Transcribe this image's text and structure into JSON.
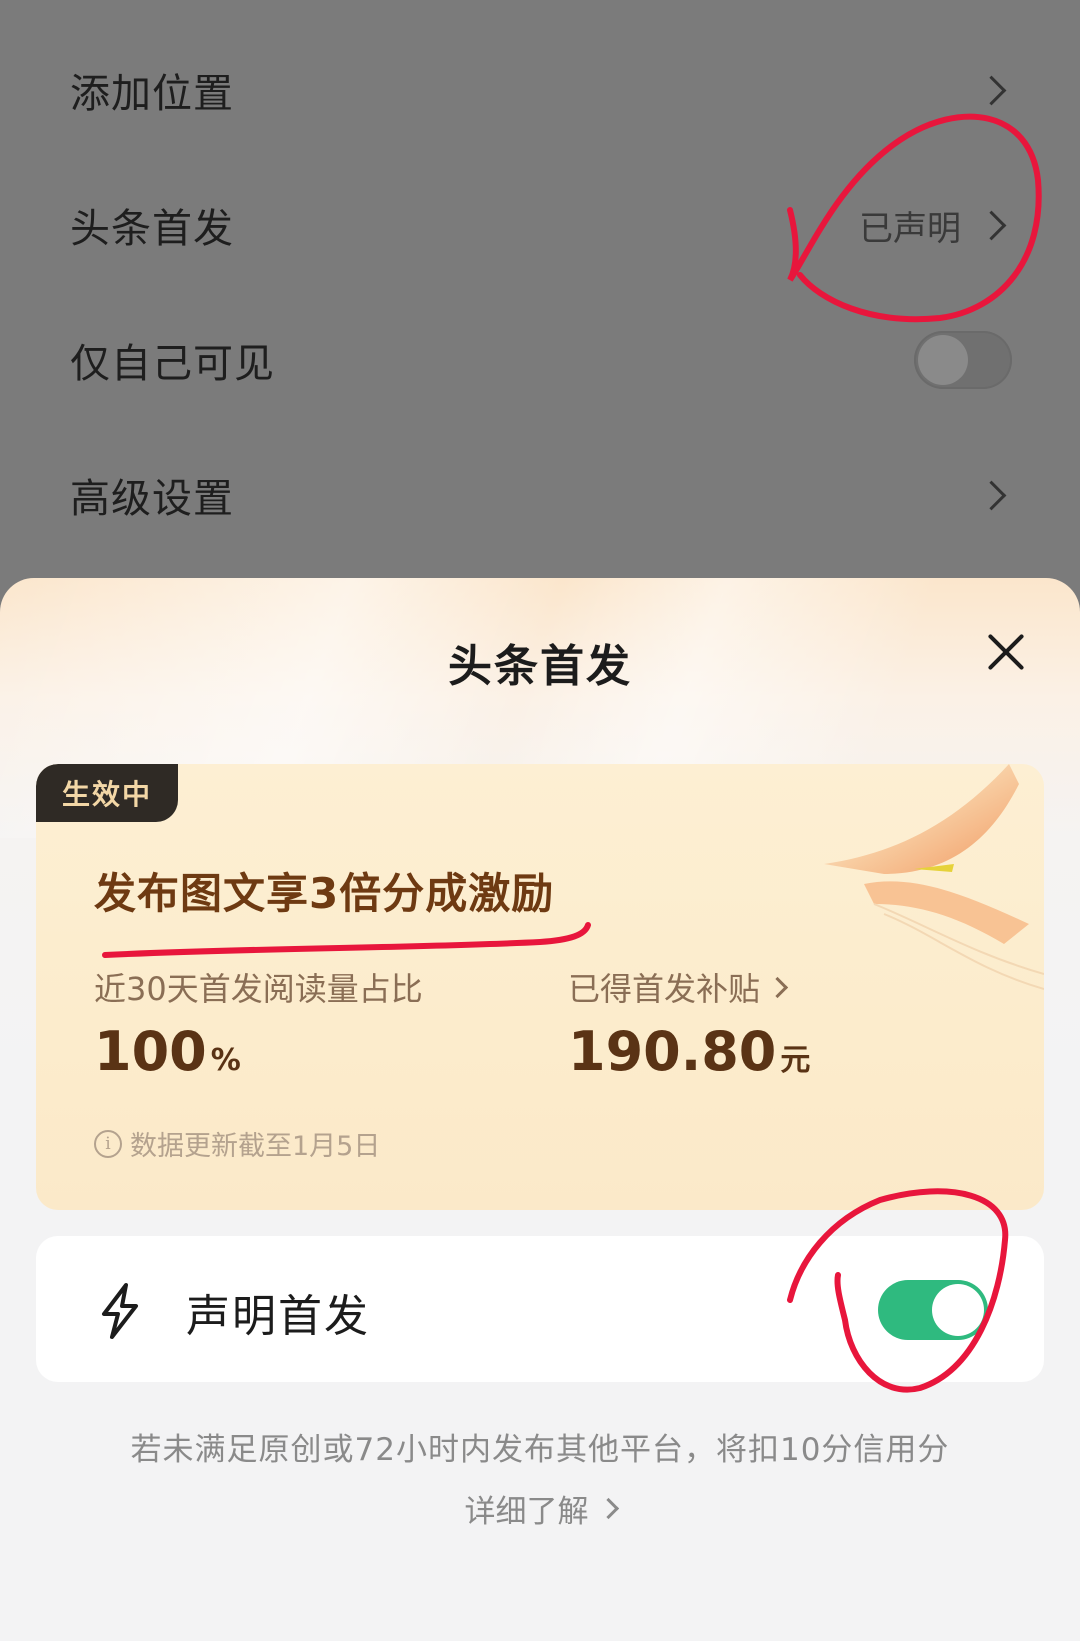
{
  "settings": {
    "rows": [
      {
        "label": "添加位置"
      },
      {
        "label": "头条首发",
        "value": "已声明"
      },
      {
        "label": "仅自己可见"
      },
      {
        "label": "高级设置"
      }
    ]
  },
  "sheet": {
    "title": "头条首发",
    "card": {
      "badge": "生效中",
      "headline": "发布图文享3倍分成激励",
      "stat1": {
        "label": "近30天首发阅读量占比",
        "value": "100",
        "unit": "%"
      },
      "stat2": {
        "label": "已得首发补贴",
        "value": "190.80",
        "unit": "元"
      },
      "update_note": "数据更新截至1月5日"
    },
    "declare": {
      "label": "声明首发",
      "enabled": true
    },
    "footer_note": "若未满足原创或72小时内发布其他平台，将扣10分信用分",
    "learn_more": "详细了解"
  },
  "colors": {
    "toggle_on": "#2fba7f",
    "annotation": "#e8163c",
    "headline": "#6e3a12"
  }
}
